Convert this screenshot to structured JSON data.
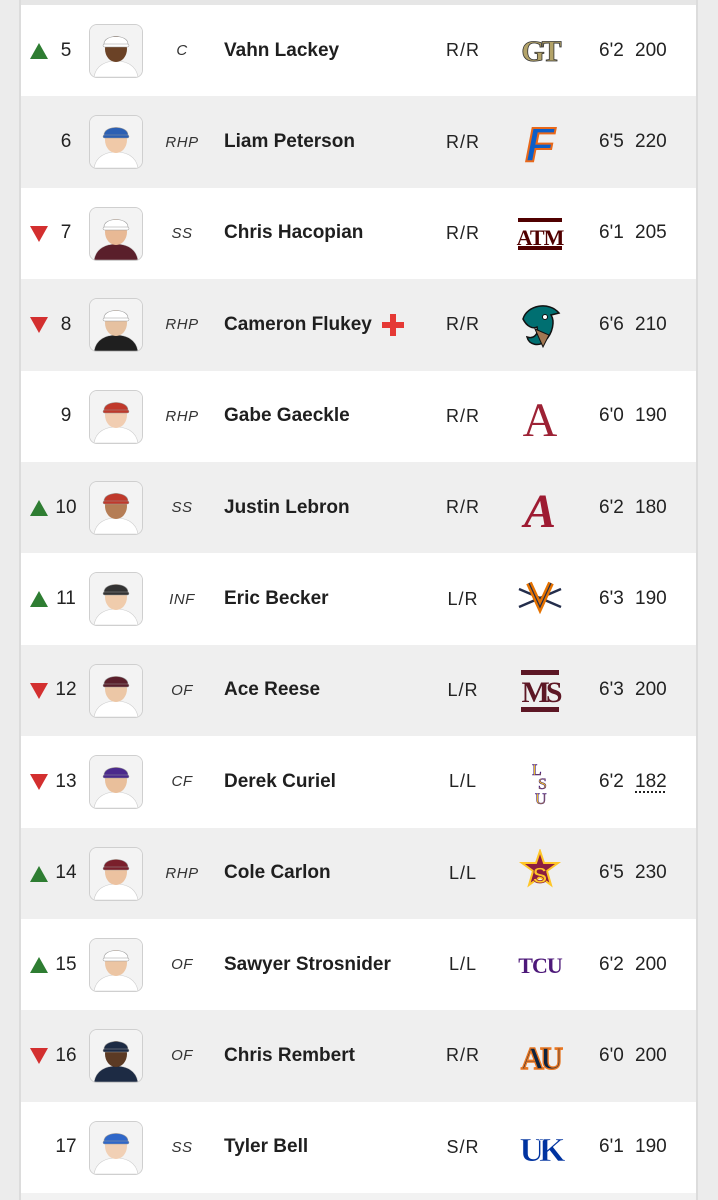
{
  "players": [
    {
      "rank": "5",
      "trend": "up",
      "pos": "C",
      "name": "Vahn Lackey",
      "injured": false,
      "bt": "R/R",
      "school_logo": "georgia-tech-logo",
      "height": "6'2",
      "weight": "200"
    },
    {
      "rank": "6",
      "trend": "none",
      "pos": "RHP",
      "name": "Liam Peterson",
      "injured": false,
      "bt": "R/R",
      "school_logo": "florida-logo",
      "height": "6'5",
      "weight": "220"
    },
    {
      "rank": "7",
      "trend": "down",
      "pos": "SS",
      "name": "Chris Hacopian",
      "injured": false,
      "bt": "R/R",
      "school_logo": "texas-am-logo",
      "height": "6'1",
      "weight": "205"
    },
    {
      "rank": "8",
      "trend": "down",
      "pos": "RHP",
      "name": "Cameron Flukey",
      "injured": true,
      "bt": "R/R",
      "school_logo": "coastal-carolina-logo",
      "height": "6'6",
      "weight": "210"
    },
    {
      "rank": "9",
      "trend": "none",
      "pos": "RHP",
      "name": "Gabe Gaeckle",
      "injured": false,
      "bt": "R/R",
      "school_logo": "arkansas-logo",
      "height": "6'0",
      "weight": "190"
    },
    {
      "rank": "10",
      "trend": "up",
      "pos": "SS",
      "name": "Justin Lebron",
      "injured": false,
      "bt": "R/R",
      "school_logo": "alabama-logo",
      "height": "6'2",
      "weight": "180"
    },
    {
      "rank": "11",
      "trend": "up",
      "pos": "INF",
      "name": "Eric Becker",
      "injured": false,
      "bt": "L/R",
      "school_logo": "virginia-logo",
      "height": "6'3",
      "weight": "190"
    },
    {
      "rank": "12",
      "trend": "down",
      "pos": "OF",
      "name": "Ace Reese",
      "injured": false,
      "bt": "L/R",
      "school_logo": "mississippi-state-logo",
      "height": "6'3",
      "weight": "200"
    },
    {
      "rank": "13",
      "trend": "down",
      "pos": "CF",
      "name": "Derek Curiel",
      "injured": false,
      "bt": "L/L",
      "school_logo": "lsu-logo",
      "height": "6'2",
      "weight": "182"
    },
    {
      "rank": "14",
      "trend": "up",
      "pos": "RHP",
      "name": "Cole Carlon",
      "injured": false,
      "bt": "L/L",
      "school_logo": "arizona-state-logo",
      "height": "6'5",
      "weight": "230"
    },
    {
      "rank": "15",
      "trend": "up",
      "pos": "OF",
      "name": "Sawyer Strosnider",
      "injured": false,
      "bt": "L/L",
      "school_logo": "tcu-logo",
      "height": "6'2",
      "weight": "200"
    },
    {
      "rank": "16",
      "trend": "down",
      "pos": "OF",
      "name": "Chris Rembert",
      "injured": false,
      "bt": "R/R",
      "school_logo": "auburn-logo",
      "height": "6'0",
      "weight": "200"
    },
    {
      "rank": "17",
      "trend": "none",
      "pos": "SS",
      "name": "Tyler Bell",
      "injured": false,
      "bt": "S/R",
      "school_logo": "kentucky-logo",
      "height": "6'1",
      "weight": "190"
    }
  ],
  "logo_text": {
    "georgia-tech-logo": "GT",
    "florida-logo": "F",
    "texas-am-logo": "ATM",
    "arkansas-logo": "A",
    "alabama-logo": "A",
    "virginia-logo": "V",
    "mississippi-state-logo": "MS",
    "lsu-logo": "LSU",
    "arizona-state-logo": "S",
    "tcu-logo": "TCU",
    "auburn-logo": "AU",
    "kentucky-logo": "UK"
  },
  "colors": {
    "up": "#2e7d32",
    "down": "#d32f2f",
    "injury": "#e53935",
    "row_odd": "#ffffff",
    "row_even": "#efefef"
  }
}
